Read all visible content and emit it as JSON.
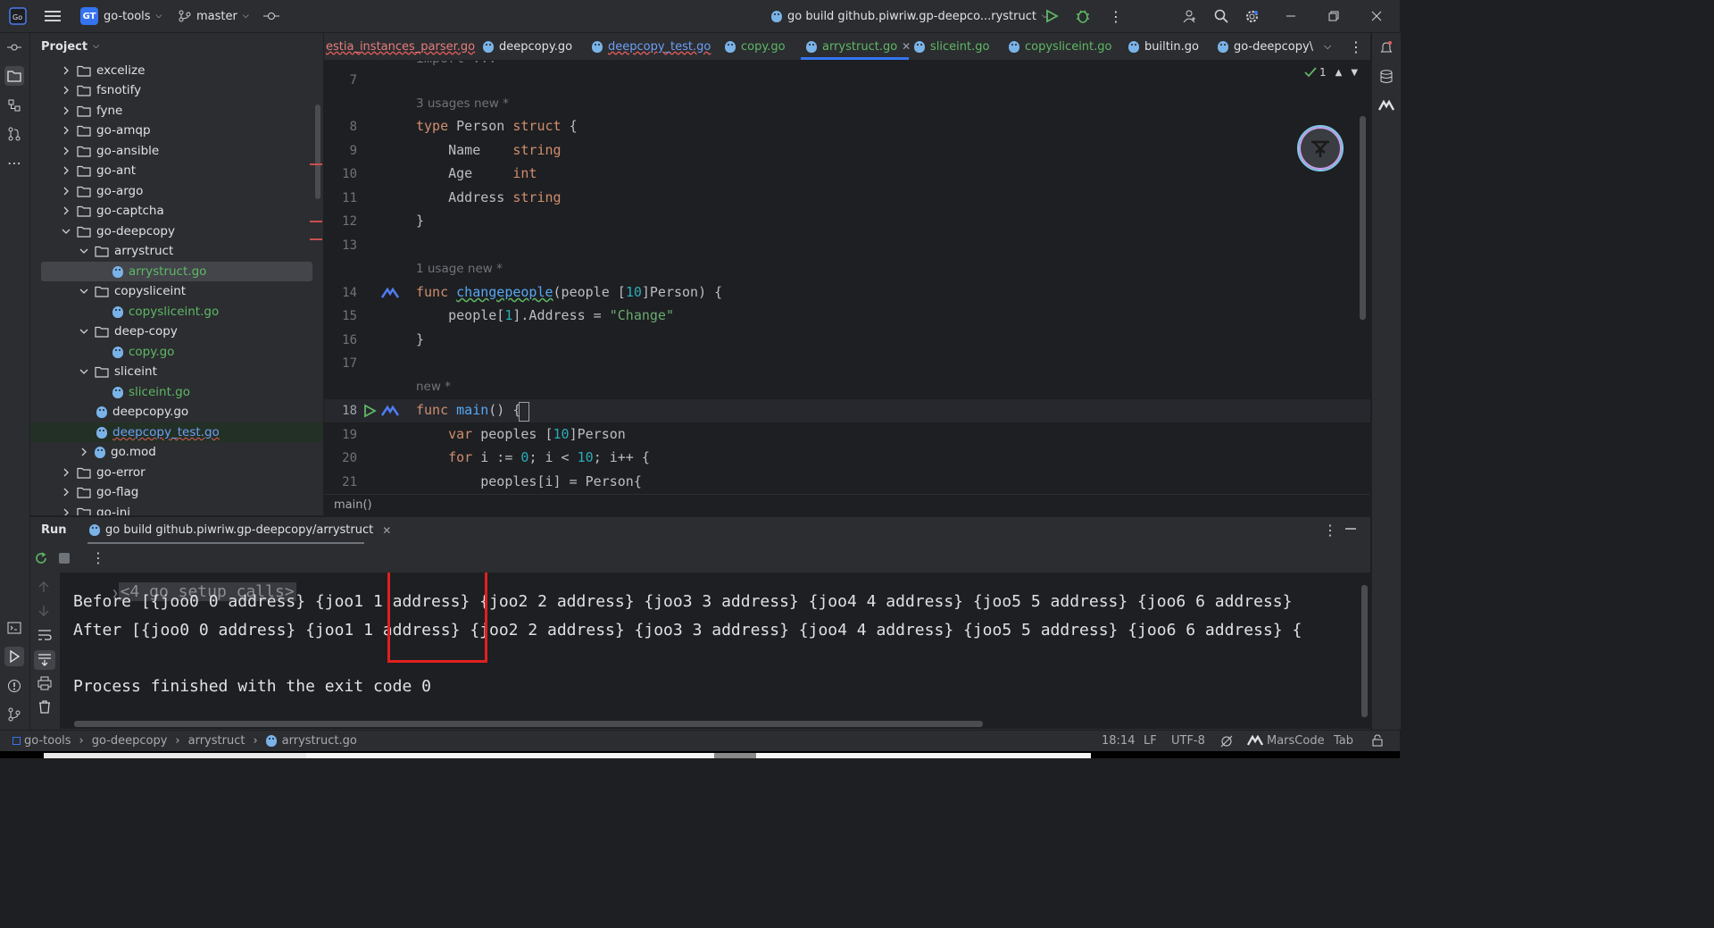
{
  "titlebar": {
    "project_initials": "GT",
    "project_name": "go-tools",
    "branch": "master",
    "run_config": "go build github.piwriw.gp-deepco...rystruct"
  },
  "project_panel": {
    "title": "Project",
    "items": [
      {
        "label": "excelize",
        "kind": "folder",
        "expanded": false
      },
      {
        "label": "fsnotify",
        "kind": "folder",
        "expanded": false
      },
      {
        "label": "fyne",
        "kind": "folder",
        "expanded": false
      },
      {
        "label": "go-amqp",
        "kind": "folder",
        "expanded": false
      },
      {
        "label": "go-ansible",
        "kind": "folder",
        "expanded": false
      },
      {
        "label": "go-ant",
        "kind": "folder",
        "expanded": false
      },
      {
        "label": "go-argo",
        "kind": "folder",
        "expanded": false
      },
      {
        "label": "go-captcha",
        "kind": "folder",
        "expanded": false
      },
      {
        "label": "go-deepcopy",
        "kind": "folder",
        "expanded": true
      },
      {
        "label": "arrystruct",
        "kind": "folder",
        "expanded": true
      },
      {
        "label": "arrystruct.go",
        "kind": "gofile"
      },
      {
        "label": "copysliceint",
        "kind": "folder",
        "expanded": true
      },
      {
        "label": "copysliceint.go",
        "kind": "gofile"
      },
      {
        "label": "deep-copy",
        "kind": "folder",
        "expanded": true
      },
      {
        "label": "copy.go",
        "kind": "gofile"
      },
      {
        "label": "sliceint",
        "kind": "folder",
        "expanded": true
      },
      {
        "label": "sliceint.go",
        "kind": "gofile"
      },
      {
        "label": "deepcopy.go",
        "kind": "gofile"
      },
      {
        "label": "deepcopy_test.go",
        "kind": "gofile"
      },
      {
        "label": "go.mod",
        "kind": "modfile"
      },
      {
        "label": "go-error",
        "kind": "folder",
        "expanded": false
      },
      {
        "label": "go-flag",
        "kind": "folder",
        "expanded": false
      },
      {
        "label": "go-ini",
        "kind": "folder",
        "expanded": false
      }
    ]
  },
  "tabs": [
    {
      "label": "estia_instances_parser.go"
    },
    {
      "label": "deepcopy.go"
    },
    {
      "label": "deepcopy_test.go"
    },
    {
      "label": "copy.go"
    },
    {
      "label": "arrystruct.go",
      "active": true
    },
    {
      "label": "sliceint.go"
    },
    {
      "label": "copysliceint.go"
    },
    {
      "label": "builtin.go"
    },
    {
      "label": "go-deepcopy\\"
    }
  ],
  "editor": {
    "inspection_count": "1",
    "hints": {
      "type_person": "3 usages   new *",
      "changepeople": "1 usage   new *",
      "main": "new *"
    },
    "line_numbers": [
      "7",
      "8",
      "9",
      "10",
      "11",
      "12",
      "13",
      "14",
      "15",
      "16",
      "17",
      "18",
      "19",
      "20",
      "21"
    ],
    "breadcrumb": "main()",
    "lines": {
      "l8_kw": "type",
      "l8_name": " Person ",
      "l8_kw2": "struct",
      "l8_rest": " {",
      "l9_field": "    Name    ",
      "l9_type": "string",
      "l10_field": "    Age     ",
      "l10_type": "int",
      "l11_field": "    Address ",
      "l11_type": "string",
      "l12": "}",
      "l14_kw": "func",
      "l14_fn": "changepeople",
      "l14_rest1": "(people [",
      "l14_num": "10",
      "l14_rest2": "]Person) {",
      "l15_a": "    people[",
      "l15_num": "1",
      "l15_b": "].Address = ",
      "l15_str": "\"Change\"",
      "l16": "}",
      "l18_kw": "func",
      "l18_fn": "main",
      "l18_rest": "() {",
      "l19_kw": "    var",
      "l19_a": " peoples [",
      "l19_num": "10",
      "l19_b": "]Person",
      "l20_kw": "    for",
      "l20_a": " i := ",
      "l20_num1": "0",
      "l20_b": "; i < ",
      "l20_num2": "10",
      "l20_c": "; i++ {",
      "l21_a": "        peoples[i] = Person{"
    }
  },
  "run_panel": {
    "title": "Run",
    "tab_label": "go build github.piwriw.gp-deepcopy/arrystruct",
    "console": [
      "<4 go setup calls>",
      "Before [{joo0 0 address} {joo1 1 address} {joo2 2 address} {joo3 3 address} {joo4 4 address} {joo5 5 address} {joo6 6 address}",
      "After [{joo0 0 address} {joo1 1 address} {joo2 2 address} {joo3 3 address} {joo4 4 address} {joo5 5 address} {joo6 6 address} {",
      "",
      "Process finished with the exit code 0"
    ],
    "highlight_color": "#e02020"
  },
  "statusbar": {
    "breadcrumbs": [
      "go-tools",
      "go-deepcopy",
      "arrystruct",
      "arrystruct.go"
    ],
    "position": "18:14",
    "line_sep": "LF",
    "encoding": "UTF-8",
    "plugin": "MarsCode",
    "indent": "Tab"
  }
}
